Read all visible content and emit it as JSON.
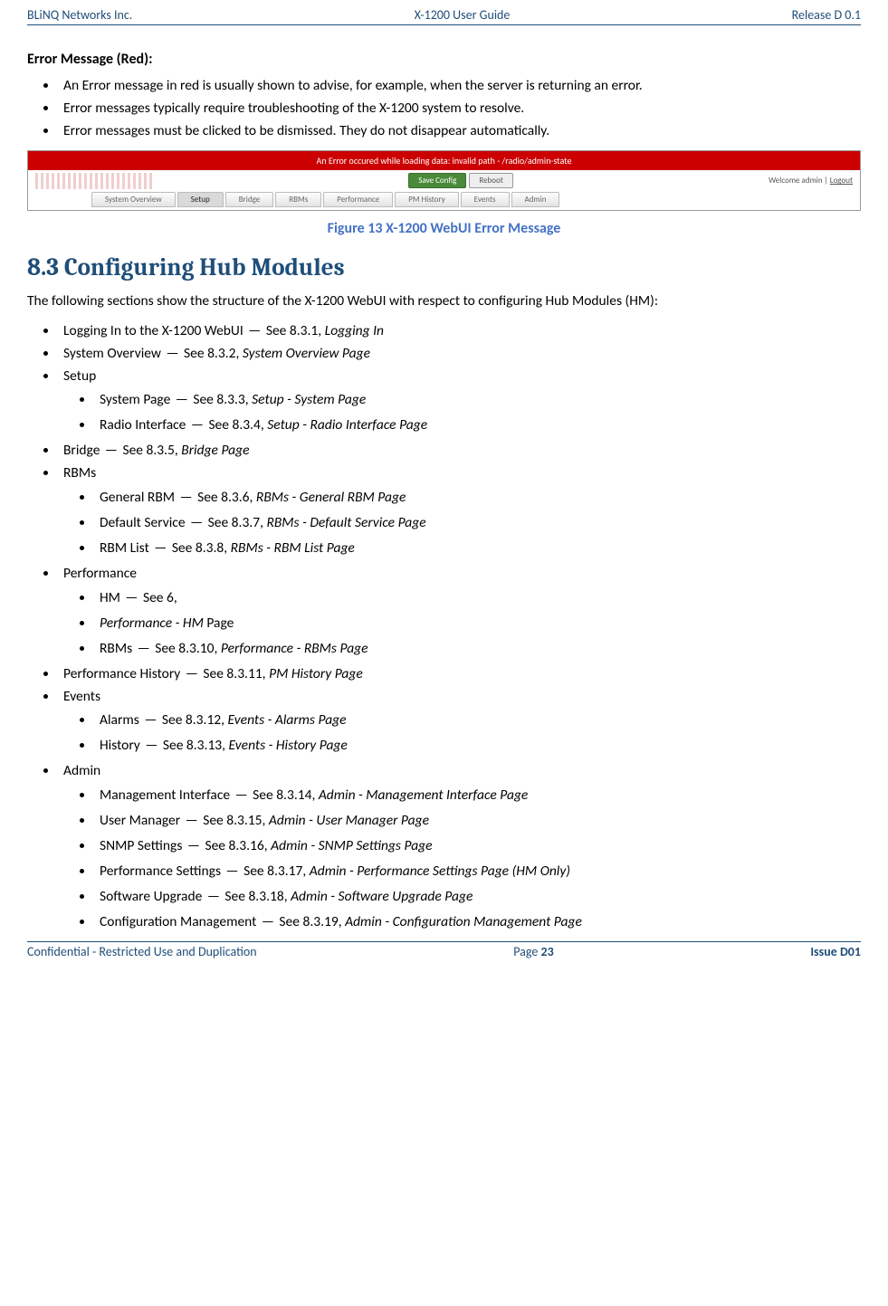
{
  "header": {
    "left": "BLiNQ Networks Inc.",
    "center": "X-1200 User Guide",
    "right": "Release D 0.1"
  },
  "errorSection": {
    "title": "Error Message (Red):",
    "bullets": [
      "An Error message in red is usually shown to advise, for example, when the server is returning an error.",
      "Error messages typically require troubleshooting of the X-1200 system to resolve.",
      "Error messages must be clicked to be dismissed. They do not disappear automatically."
    ]
  },
  "screenshot": {
    "errorBar": "An Error occured while loading data: invalid path - /radio/admin-state",
    "btnSave": "Save Config",
    "btnReboot": "Reboot",
    "welcomePrefix": "Welcome admin  |",
    "logout": "Logout",
    "tabs": [
      "System Overview",
      "Setup",
      "Bridge",
      "RBMs",
      "Performance",
      "PM History",
      "Events",
      "Admin"
    ],
    "activeTabIndex": 1
  },
  "figureCaption": "Figure 13   X-1200 WebUI Error Message",
  "heading": "8.3  Configuring Hub Modules",
  "intro": "The following sections show the structure of the X-1200 WebUI with respect to configuring Hub Modules (HM):",
  "toc": [
    {
      "label": "Logging In to the X-1200 WebUI",
      "ref": "See 8.3.1,",
      "page": "Logging In"
    },
    {
      "label": "System Overview",
      "ref": "See 8.3.2,",
      "page": "System Overview Page"
    },
    {
      "label": "Setup",
      "children": [
        {
          "label": "System Page",
          "ref": "See 8.3.3,",
          "page": "Setup - System Page"
        },
        {
          "label": "Radio Interface",
          "ref": "See 8.3.4,",
          "page": "Setup - Radio Interface Page"
        }
      ]
    },
    {
      "label": "Bridge",
      "ref": "See 8.3.5,",
      "page": "Bridge Page"
    },
    {
      "label": "RBMs",
      "children": [
        {
          "label": "General RBM",
          "ref": "See 8.3.6,",
          "page": "RBMs - General RBM Page"
        },
        {
          "label": "Default Service",
          "ref": "See 8.3.7,",
          "page": "RBMs - Default Service Page"
        },
        {
          "label": "RBM List",
          "ref": "See 8.3.8,",
          "page": "RBMs - RBM List Page"
        }
      ]
    },
    {
      "label": "Performance",
      "children": [
        {
          "label": "HM",
          "ref": "See 6,"
        },
        {
          "pageOnlyPrefix": "Performance - HM",
          "pageOnlySuffix": " Page"
        },
        {
          "label": "RBMs",
          "ref": "See 8.3.10,",
          "page": "Performance - RBMs Page"
        }
      ]
    },
    {
      "label": "Performance History",
      "ref": "See 8.3.11,",
      "page": "PM History Page"
    },
    {
      "label": "Events",
      "children": [
        {
          "label": "Alarms",
          "ref": "See 8.3.12,",
          "page": "Events - Alarms Page"
        },
        {
          "label": "History",
          "ref": "See 8.3.13,",
          "page": "Events - History Page"
        }
      ]
    },
    {
      "label": "Admin",
      "children": [
        {
          "label": "Management Interface",
          "ref": "See 8.3.14,",
          "page": "Admin - Management Interface Page"
        },
        {
          "label": "User Manager",
          "ref": "See 8.3.15,",
          "page": "Admin - User Manager Page"
        },
        {
          "label": "SNMP Settings",
          "ref": "See 8.3.16,",
          "page": "Admin - SNMP Settings Page"
        },
        {
          "label": "Performance Settings",
          "ref": "See 8.3.17,",
          "page": "Admin - Performance Settings Page (HM Only)"
        },
        {
          "label": "Software Upgrade",
          "ref": "See 8.3.18,",
          "page": "Admin - Software Upgrade Page"
        },
        {
          "label": "Configuration Management",
          "ref": "See 8.3.19,",
          "page": "Admin - Configuration Management Page"
        }
      ]
    }
  ],
  "footer": {
    "left": "Confidential - Restricted Use and Duplication",
    "centerPrefix": "Page ",
    "centerPage": "23",
    "right": "Issue D01"
  }
}
